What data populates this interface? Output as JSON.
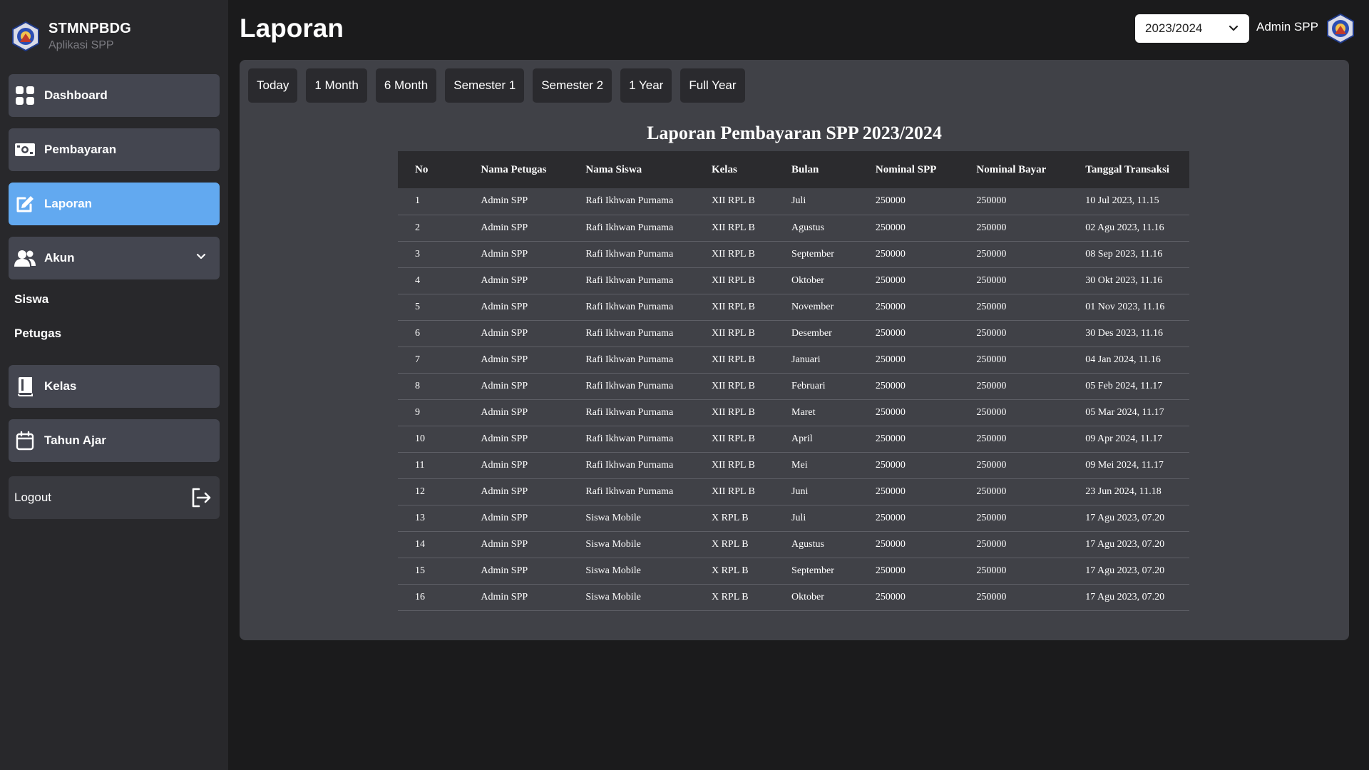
{
  "brand": {
    "name": "STMNPBDG",
    "subtitle": "Aplikasi SPP"
  },
  "sidebar": {
    "dashboard": "Dashboard",
    "pembayaran": "Pembayaran",
    "laporan": "Laporan",
    "akun": "Akun",
    "siswa": "Siswa",
    "petugas": "Petugas",
    "kelas": "Kelas",
    "tahun_ajar": "Tahun Ajar",
    "logout": "Logout"
  },
  "header": {
    "title": "Laporan",
    "year_selected": "2023/2024",
    "user_name": "Admin SPP"
  },
  "filters": [
    "Today",
    "1 Month",
    "6 Month",
    "Semester 1",
    "Semester 2",
    "1 Year",
    "Full Year"
  ],
  "report": {
    "title": "Laporan Pembayaran SPP 2023/2024",
    "columns": [
      "No",
      "Nama Petugas",
      "Nama Siswa",
      "Kelas",
      "Bulan",
      "Nominal SPP",
      "Nominal Bayar",
      "Tanggal Transaksi"
    ],
    "rows": [
      [
        "1",
        "Admin SPP",
        "Rafi Ikhwan Purnama",
        "XII RPL B",
        "Juli",
        "250000",
        "250000",
        "10 Jul 2023, 11.15"
      ],
      [
        "2",
        "Admin SPP",
        "Rafi Ikhwan Purnama",
        "XII RPL B",
        "Agustus",
        "250000",
        "250000",
        "02 Agu 2023, 11.16"
      ],
      [
        "3",
        "Admin SPP",
        "Rafi Ikhwan Purnama",
        "XII RPL B",
        "September",
        "250000",
        "250000",
        "08 Sep 2023, 11.16"
      ],
      [
        "4",
        "Admin SPP",
        "Rafi Ikhwan Purnama",
        "XII RPL B",
        "Oktober",
        "250000",
        "250000",
        "30 Okt 2023, 11.16"
      ],
      [
        "5",
        "Admin SPP",
        "Rafi Ikhwan Purnama",
        "XII RPL B",
        "November",
        "250000",
        "250000",
        "01 Nov 2023, 11.16"
      ],
      [
        "6",
        "Admin SPP",
        "Rafi Ikhwan Purnama",
        "XII RPL B",
        "Desember",
        "250000",
        "250000",
        "30 Des 2023, 11.16"
      ],
      [
        "7",
        "Admin SPP",
        "Rafi Ikhwan Purnama",
        "XII RPL B",
        "Januari",
        "250000",
        "250000",
        "04 Jan 2024, 11.16"
      ],
      [
        "8",
        "Admin SPP",
        "Rafi Ikhwan Purnama",
        "XII RPL B",
        "Februari",
        "250000",
        "250000",
        "05 Feb 2024, 11.17"
      ],
      [
        "9",
        "Admin SPP",
        "Rafi Ikhwan Purnama",
        "XII RPL B",
        "Maret",
        "250000",
        "250000",
        "05 Mar 2024, 11.17"
      ],
      [
        "10",
        "Admin SPP",
        "Rafi Ikhwan Purnama",
        "XII RPL B",
        "April",
        "250000",
        "250000",
        "09 Apr 2024, 11.17"
      ],
      [
        "11",
        "Admin SPP",
        "Rafi Ikhwan Purnama",
        "XII RPL B",
        "Mei",
        "250000",
        "250000",
        "09 Mei 2024, 11.17"
      ],
      [
        "12",
        "Admin SPP",
        "Rafi Ikhwan Purnama",
        "XII RPL B",
        "Juni",
        "250000",
        "250000",
        "23 Jun 2024, 11.18"
      ],
      [
        "13",
        "Admin SPP",
        "Siswa Mobile",
        "X RPL B",
        "Juli",
        "250000",
        "250000",
        "17 Agu 2023, 07.20"
      ],
      [
        "14",
        "Admin SPP",
        "Siswa Mobile",
        "X RPL B",
        "Agustus",
        "250000",
        "250000",
        "17 Agu 2023, 07.20"
      ],
      [
        "15",
        "Admin SPP",
        "Siswa Mobile",
        "X RPL B",
        "September",
        "250000",
        "250000",
        "17 Agu 2023, 07.20"
      ],
      [
        "16",
        "Admin SPP",
        "Siswa Mobile",
        "X RPL B",
        "Oktober",
        "250000",
        "250000",
        "17 Agu 2023, 07.20"
      ]
    ]
  },
  "colors": {
    "background": "#1b1b1c",
    "sidebar": "#28282b",
    "nav_item": "#444650",
    "nav_active": "#62a9f0",
    "panel": "#404147",
    "table_header": "#2b2b2e"
  },
  "icons": {
    "brand": "school-logo",
    "dashboard": "grid-icon",
    "pembayaran": "money-icon",
    "laporan": "edit-report-icon",
    "akun": "users-icon",
    "kelas": "book-icon",
    "tahun_ajar": "calendar-icon",
    "logout": "logout-icon",
    "dropdown": "chevron-down-icon"
  }
}
